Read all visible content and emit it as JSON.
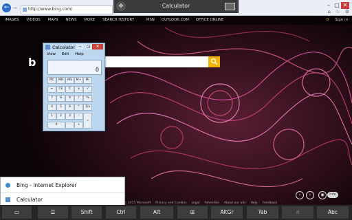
{
  "browser": {
    "url": "http://www.bing.com/",
    "back_label": "←",
    "forward_label": "→",
    "minimize": "–",
    "maximize": "□",
    "close": "✕",
    "home": "⌂",
    "favorites": "☆",
    "tools": "⚙"
  },
  "remote": {
    "title": "Calculator"
  },
  "bing": {
    "nav_left": [
      "IMAGES",
      "VIDEOS",
      "MAPS",
      "NEWS",
      "MORE",
      "SEARCH HISTORY"
    ],
    "nav_middle": [
      "MSN",
      "OUTLOOK.COM",
      "OFFICE ONLINE"
    ],
    "rewards": "0",
    "sign_in": "Sign in",
    "logo": "b",
    "footer": [
      "© 2015 Microsoft",
      "Privacy and Cookies",
      "Legal",
      "Advertise",
      "About our ads",
      "Help",
      "Feedback"
    ],
    "info_label": "Info",
    "prev_label": "‹",
    "next_label": "›",
    "camera_label": "◉"
  },
  "calculator": {
    "title": "Calculator",
    "menu": [
      "View",
      "Edit",
      "Help"
    ],
    "display": "0",
    "min": "–",
    "max": "□",
    "close": "✕",
    "keys": [
      [
        "MC",
        "MR",
        "MS",
        "M+",
        "M-"
      ],
      [
        "←",
        "CE",
        "C",
        "±",
        "√"
      ],
      [
        "7",
        "8",
        "9",
        "/",
        "%"
      ],
      [
        "4",
        "5",
        "6",
        "*",
        "1/x"
      ],
      [
        "1",
        "2",
        "3",
        "-",
        "="
      ],
      [
        "0",
        ".",
        "+"
      ]
    ]
  },
  "switcher": {
    "items": [
      {
        "label": "Bing - Internet Explorer"
      },
      {
        "label": "Calculator"
      }
    ]
  },
  "keyboard": {
    "keys": [
      "",
      "",
      "Shift",
      "Ctrl",
      "Alt",
      "",
      "AltGr",
      "Tab",
      "",
      "Abc"
    ]
  },
  "colors": {
    "search_accent": "#f0b500",
    "calc_frame": "#bcd7ed",
    "close_red": "#c9463d"
  }
}
